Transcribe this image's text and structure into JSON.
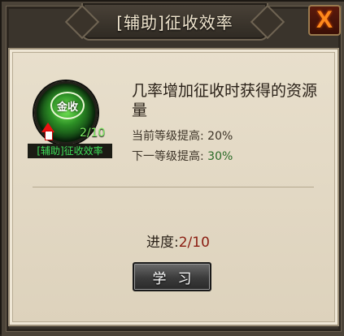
{
  "window": {
    "title": "[辅助]征收效率",
    "close_label": "X"
  },
  "skill": {
    "icon_glyph": "金收",
    "level": "2/10",
    "name": "[辅助]征收效率",
    "icon": "gold-collect-icon",
    "upgrade_icon": "red-up-arrow-icon"
  },
  "description": "几率增加征收时获得的资源量",
  "stats": {
    "current_label": "当前等级提高: ",
    "current_value": "20%",
    "next_label": "下一等级提高: ",
    "next_value": "30%"
  },
  "progress": {
    "label": "进度:",
    "value": "2/10"
  },
  "actions": {
    "learn_label": "学习"
  },
  "colors": {
    "accent_orange": "#ff8a1c",
    "progress_red": "#8a1c10",
    "next_value_green": "#2a6b27",
    "skill_green": "#3fe05a"
  }
}
